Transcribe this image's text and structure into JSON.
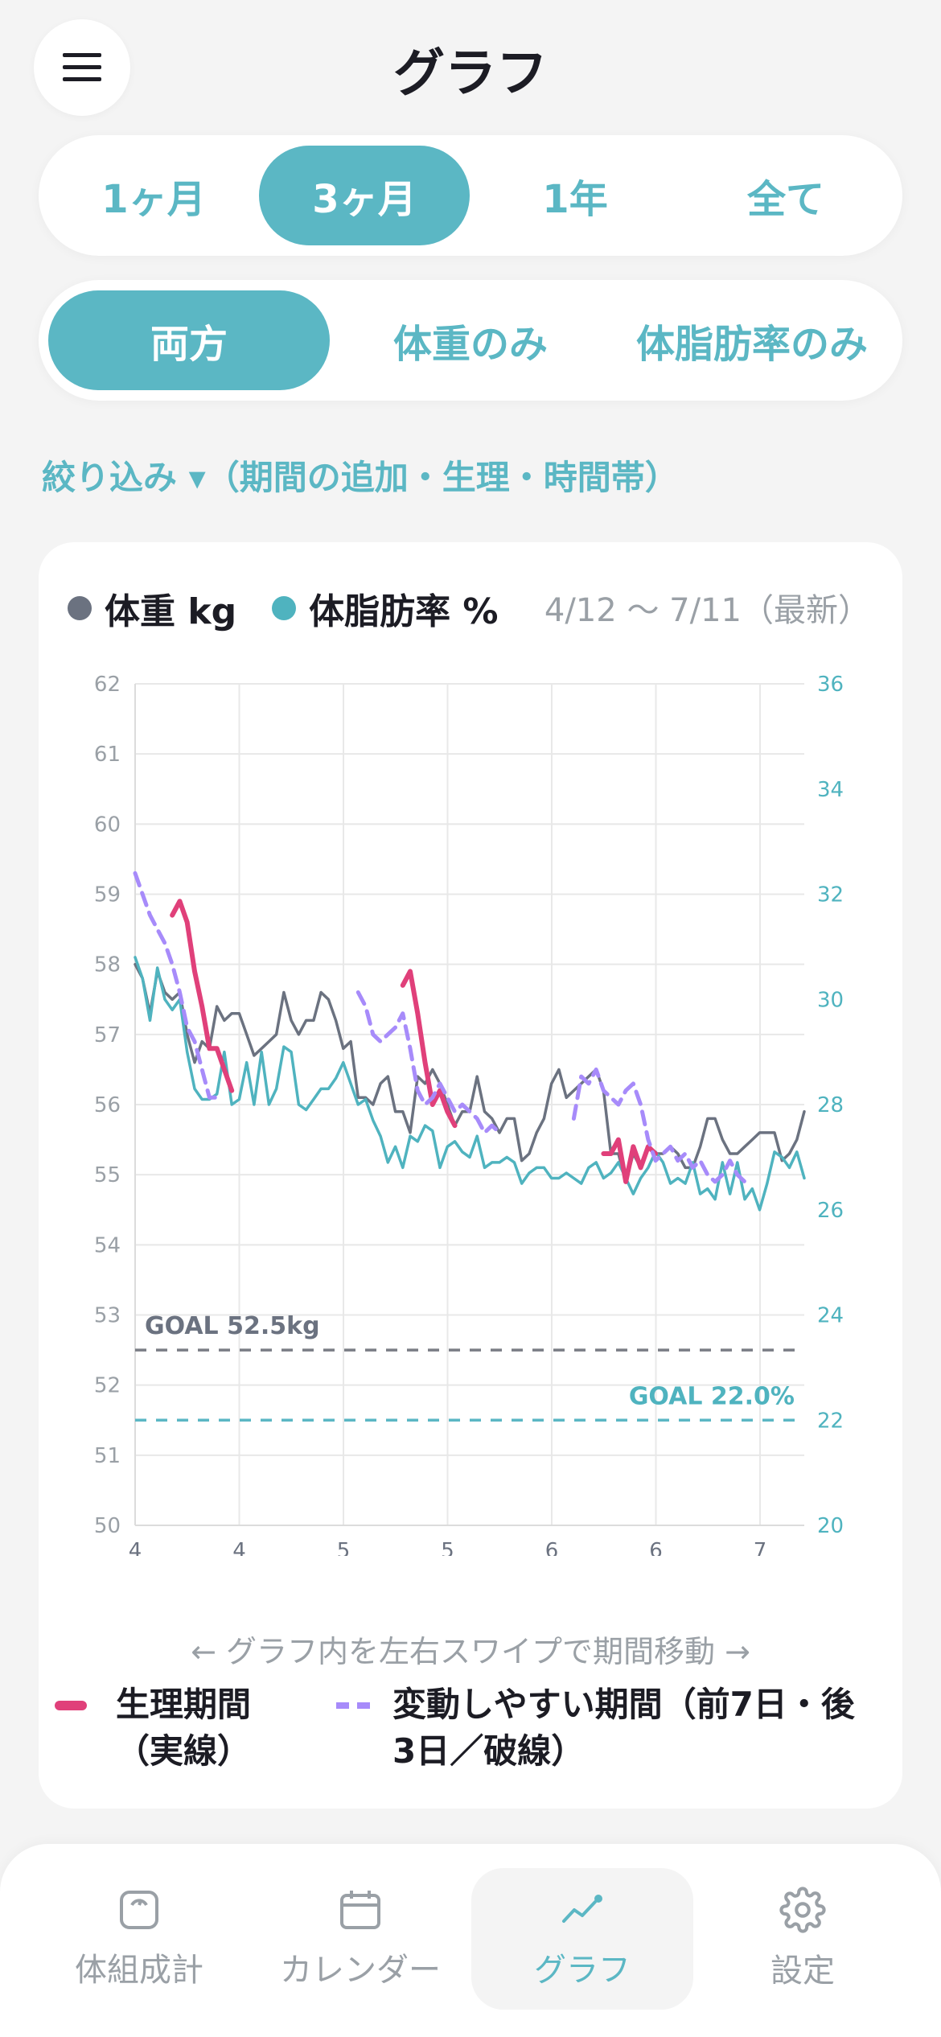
{
  "header": {
    "title": "グラフ"
  },
  "period_tabs": [
    {
      "label": "1ヶ月",
      "active": false
    },
    {
      "label": "3ヶ月",
      "active": true
    },
    {
      "label": "1年",
      "active": false
    },
    {
      "label": "全て",
      "active": false
    }
  ],
  "mode_tabs": [
    {
      "label": "両方",
      "active": true
    },
    {
      "label": "体重のみ",
      "active": false
    },
    {
      "label": "体脂肪率のみ",
      "active": false
    }
  ],
  "filter": {
    "label": "絞り込み ▾（期間の追加・生理・時間帯）"
  },
  "chart_card": {
    "legend_weight": "体重 kg",
    "legend_fat": "体脂肪率 %",
    "range_label": "4/12 〜 7/11（最新）",
    "swipe_hint": "← グラフ内を左右スワイプで期間移動 →",
    "legend_period": "生理期間（実線）",
    "legend_fluct": "変動しやすい期間（前7日・後3日／破線）"
  },
  "chart_data": {
    "type": "line",
    "x_tick_labels": [
      "4",
      "4",
      "5",
      "5",
      "6",
      "6",
      "7"
    ],
    "y_left": {
      "ylim": [
        50,
        62
      ],
      "ticks": [
        "50",
        "51",
        "52",
        "53",
        "54",
        "55",
        "56",
        "57",
        "58",
        "59",
        "60",
        "61",
        "62"
      ]
    },
    "y_right": {
      "ylim": [
        20,
        36
      ],
      "ticks": [
        "20",
        "22",
        "24",
        "26",
        "28",
        "30",
        "32",
        "34",
        "36"
      ]
    },
    "goal_weight": {
      "label": "GOAL 52.5kg",
      "value": 52.5
    },
    "goal_fat": {
      "label": "GOAL 22.0%",
      "value": 22.0
    },
    "x_day_range": [
      0,
      90
    ],
    "series": [
      {
        "name": "体重 kg",
        "axis": "left",
        "color": "#6b7280",
        "x": [
          0,
          1,
          2,
          3,
          4,
          5,
          6,
          7,
          8,
          9,
          10,
          11,
          12,
          13,
          14,
          15,
          16,
          17,
          18,
          19,
          20,
          21,
          22,
          23,
          24,
          25,
          26,
          27,
          28,
          29,
          30,
          31,
          32,
          33,
          34,
          35,
          36,
          37,
          38,
          39,
          40,
          41,
          42,
          43,
          44,
          45,
          46,
          47,
          48,
          49,
          50,
          51,
          52,
          53,
          54,
          55,
          56,
          57,
          58,
          59,
          60,
          61,
          62,
          63,
          64,
          65,
          66,
          67,
          68,
          69,
          70,
          71,
          72,
          73,
          74,
          75,
          76,
          77,
          78,
          79,
          80,
          81,
          82,
          83,
          84,
          85,
          86,
          87,
          88,
          89,
          90
        ],
        "y": [
          58.0,
          57.8,
          57.3,
          57.9,
          57.6,
          57.5,
          57.6,
          57.0,
          56.6,
          56.9,
          56.8,
          57.4,
          57.2,
          57.3,
          57.3,
          57.0,
          56.7,
          56.8,
          56.9,
          57.0,
          57.6,
          57.2,
          57.0,
          57.2,
          57.2,
          57.6,
          57.5,
          57.2,
          56.8,
          56.9,
          56.1,
          56.1,
          56.0,
          56.3,
          56.4,
          55.9,
          55.9,
          55.6,
          56.4,
          56.3,
          56.5,
          56.3,
          56.0,
          55.7,
          55.9,
          55.9,
          56.4,
          55.9,
          55.8,
          55.6,
          55.8,
          55.8,
          55.2,
          55.3,
          55.6,
          55.8,
          56.3,
          56.5,
          56.1,
          56.2,
          56.3,
          56.4,
          56.5,
          56.2,
          55.3,
          55.3,
          54.9,
          55.3,
          55.1,
          55.4,
          55.3,
          55.3,
          55.4,
          55.3,
          55.1,
          55.1,
          55.4,
          55.8,
          55.8,
          55.5,
          55.3,
          55.3,
          55.4,
          55.5,
          55.6,
          55.6,
          55.6,
          55.2,
          55.3,
          55.5,
          55.9
        ]
      },
      {
        "name": "体脂肪率 %",
        "axis": "right",
        "color": "#4fb3bf",
        "x": [
          0,
          1,
          2,
          3,
          4,
          5,
          6,
          7,
          8,
          9,
          10,
          11,
          12,
          13,
          14,
          15,
          16,
          17,
          18,
          19,
          20,
          21,
          22,
          23,
          24,
          25,
          26,
          27,
          28,
          29,
          30,
          31,
          32,
          33,
          34,
          35,
          36,
          37,
          38,
          39,
          40,
          41,
          42,
          43,
          44,
          45,
          46,
          47,
          48,
          49,
          50,
          51,
          52,
          53,
          54,
          55,
          56,
          57,
          58,
          59,
          60,
          61,
          62,
          63,
          64,
          65,
          66,
          67,
          68,
          69,
          70,
          71,
          72,
          73,
          74,
          75,
          76,
          77,
          78,
          79,
          80,
          81,
          82,
          83,
          84,
          85,
          86,
          87,
          88,
          89,
          90
        ],
        "y": [
          30.8,
          30.4,
          29.6,
          30.6,
          30.0,
          29.8,
          30.0,
          29.0,
          28.3,
          28.1,
          28.1,
          28.2,
          29.0,
          28.0,
          28.1,
          28.8,
          28.0,
          29.0,
          28.0,
          28.3,
          29.1,
          29.0,
          28.0,
          27.9,
          28.1,
          28.3,
          28.3,
          28.5,
          28.8,
          28.4,
          28.0,
          28.1,
          27.7,
          27.4,
          26.9,
          27.2,
          26.8,
          27.4,
          27.3,
          27.6,
          27.5,
          26.8,
          27.2,
          27.3,
          27.1,
          27.0,
          27.4,
          26.8,
          26.9,
          26.9,
          27.0,
          26.9,
          26.5,
          26.7,
          26.8,
          26.8,
          26.6,
          26.6,
          26.7,
          26.6,
          26.5,
          26.8,
          26.9,
          26.6,
          26.7,
          26.9,
          26.6,
          26.3,
          26.6,
          26.8,
          27.1,
          26.9,
          26.5,
          26.6,
          26.5,
          26.9,
          26.3,
          26.4,
          26.2,
          26.9,
          26.3,
          26.9,
          26.2,
          26.4,
          26.0,
          26.5,
          27.1,
          27.0,
          26.8,
          27.1,
          26.6
        ]
      },
      {
        "name": "生理期間",
        "axis": "left",
        "color": "#e0407a",
        "style": "solid",
        "segments": [
          {
            "x": [
              5,
              6,
              7,
              8,
              9,
              10,
              11,
              12,
              13
            ],
            "y": [
              58.7,
              58.9,
              58.6,
              57.9,
              57.4,
              56.8,
              56.8,
              56.5,
              56.2
            ]
          },
          {
            "x": [
              36,
              37,
              38,
              39,
              40,
              41,
              42,
              43
            ],
            "y": [
              57.7,
              57.9,
              57.3,
              56.6,
              56.0,
              56.2,
              55.9,
              55.7
            ]
          },
          {
            "x": [
              63,
              64,
              65,
              66,
              67,
              68,
              69,
              70
            ],
            "y": [
              55.3,
              55.3,
              55.5,
              54.9,
              55.4,
              55.1,
              55.4,
              55.3
            ]
          }
        ]
      },
      {
        "name": "変動しやすい期間",
        "axis": "left",
        "color": "#a78bfa",
        "style": "dashed",
        "segments": [
          {
            "x": [
              0,
              1,
              2,
              3,
              4,
              5,
              6,
              7,
              8,
              9,
              10,
              11
            ],
            "y": [
              59.3,
              59.0,
              58.7,
              58.5,
              58.3,
              58.0,
              57.6,
              57.1,
              56.9,
              56.5,
              56.1,
              56.1
            ]
          },
          {
            "x": [
              30,
              31,
              32,
              33,
              34,
              35,
              36,
              37,
              38,
              39,
              40,
              41,
              42,
              43,
              44,
              45,
              46,
              47,
              48,
              49
            ],
            "y": [
              57.6,
              57.4,
              57.0,
              56.9,
              57.0,
              57.1,
              57.3,
              56.8,
              56.2,
              56.0,
              56.1,
              56.3,
              56.1,
              55.9,
              56.0,
              55.9,
              55.8,
              55.6,
              55.7,
              55.6
            ]
          },
          {
            "x": [
              59,
              60,
              61,
              62,
              63,
              64,
              65,
              66,
              67,
              68,
              69,
              70,
              71,
              72,
              73,
              74,
              75,
              76,
              77,
              78,
              79,
              80,
              81,
              82
            ],
            "y": [
              55.8,
              56.4,
              56.3,
              56.5,
              56.2,
              56.1,
              56.0,
              56.2,
              56.3,
              56.0,
              55.5,
              55.2,
              55.3,
              55.4,
              55.2,
              55.3,
              55.1,
              55.2,
              55.0,
              54.9,
              55.0,
              55.2,
              55.0,
              54.9
            ]
          }
        ]
      }
    ]
  },
  "tabbar": {
    "items": [
      {
        "label": "体組成計",
        "icon": "scale-icon",
        "active": false
      },
      {
        "label": "カレンダー",
        "icon": "calendar-icon",
        "active": false
      },
      {
        "label": "グラフ",
        "icon": "chart-line-icon",
        "active": true
      },
      {
        "label": "設定",
        "icon": "gear-icon",
        "active": false
      }
    ]
  },
  "colors": {
    "accent": "#5bb7c4",
    "weight": "#6b7280",
    "fat": "#4fb3bf",
    "period": "#e0407a",
    "fluct": "#a78bfa"
  }
}
